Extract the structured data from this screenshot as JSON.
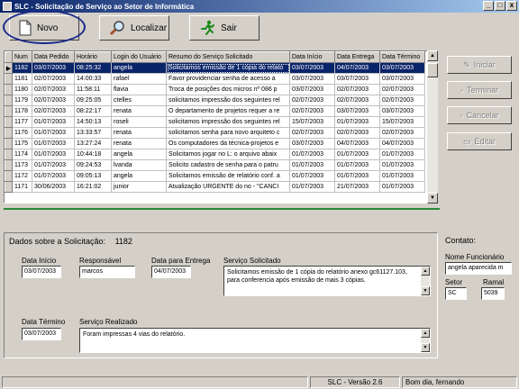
{
  "window": {
    "title": "SLC - Solicitação de Serviço ao Setor de Informática",
    "min": "_",
    "max": "□",
    "close": "x"
  },
  "toolbar": {
    "novo": "Novo",
    "localizar": "Localizar",
    "sair": "Sair"
  },
  "grid": {
    "columns": [
      "Num",
      "Data Pedido",
      "Horário",
      "Login do Usuário",
      "Resumo do Serviço Solicitado",
      "Data Início",
      "Data Entrega",
      "Data Término"
    ],
    "rows": [
      [
        "1182",
        "03/07/2003",
        "08:25:32",
        "angela",
        "Solicitamos emissão de 1 cópia do relató",
        "03/07/2003",
        "04/07/2003",
        "03/07/2003"
      ],
      [
        "1181",
        "02/07/2003",
        "14:00:33",
        "rafael",
        "Favor providenciar senha de acesso a",
        "03/07/2003",
        "03/07/2003",
        "03/07/2003"
      ],
      [
        "1180",
        "02/07/2003",
        "11:58:11",
        "flavia",
        "Troca de posições dos micros nº 086 p",
        "03/07/2003",
        "02/07/2003",
        "02/07/2003"
      ],
      [
        "1179",
        "02/07/2003",
        "09:25:05",
        "ctelles",
        "solicitamos impressão dos seguintes rel",
        "02/07/2003",
        "02/07/2003",
        "02/07/2003"
      ],
      [
        "1178",
        "02/07/2003",
        "08:22:17",
        "renata",
        "O departamento de projetos requer a re",
        "02/07/2003",
        "03/07/2003",
        "03/07/2003"
      ],
      [
        "1177",
        "01/07/2003",
        "14:50:13",
        "roseli",
        "solicitamos impressão dos seguintes rel",
        "15/07/2003",
        "01/07/2003",
        "15/07/2003"
      ],
      [
        "1176",
        "01/07/2003",
        "13:33:57",
        "renata",
        "solicitamos senha para novo arquiteto c",
        "02/07/2003",
        "02/07/2003",
        "02/07/2003"
      ],
      [
        "1175",
        "01/07/2003",
        "13:27:24",
        "renata",
        "Os computadores da técnica-projetos e",
        "03/07/2003",
        "04/07/2003",
        "04/07/2003"
      ],
      [
        "1174",
        "01/07/2003",
        "10:44:18",
        "angela",
        "Solicitamos jogar no L: o arquivo abaix",
        "01/07/2003",
        "01/07/2003",
        "01/07/2003"
      ],
      [
        "1173",
        "01/07/2003",
        "09:24:53",
        "lvanda",
        "Solicito cadastro de senha para o patru",
        "01/07/2003",
        "01/07/2003",
        "01/07/2003"
      ],
      [
        "1172",
        "01/07/2003",
        "09:05:13",
        "angela",
        "Solicitamos emissão de relatório conf. a",
        "01/07/2003",
        "01/07/2003",
        "01/07/2003"
      ],
      [
        "1171",
        "30/06/2003",
        "16:21:02",
        "junior",
        "Atualização URGENTE do no - \"CANCI",
        "01/07/2003",
        "21/07/2003",
        "01/07/2003"
      ]
    ]
  },
  "side_buttons": {
    "iniciar": "Iniciar",
    "terminar": "Terminar",
    "cancelar": "Cancelar",
    "editar": "Editar"
  },
  "details": {
    "heading": "Dados sobre a Solicitação:",
    "number": "1182",
    "data_inicio_label": "Data Início",
    "data_inicio": "03/07/2003",
    "responsavel_label": "Responsável",
    "responsavel": "marcos",
    "data_entrega_label": "Data para Entrega",
    "data_entrega": "04/07/2003",
    "servico_label": "Serviço Solicitado",
    "servico": "Solicitamos emissão de 1 cópia do relatório anexo gc61127.103,  para conferencia após emissão de mais 3 cópias.",
    "data_termino_label": "Data Término",
    "data_termino": "03/07/2003",
    "realizado_label": "Serviço Realizado",
    "realizado": "Foram impressas 4 vias do relatório."
  },
  "contact": {
    "heading": "Contato:",
    "nome_label": "Nome Funcionário",
    "nome": "angela aparecida m",
    "setor_label": "Setor",
    "setor": "SC",
    "ramal_label": "Ramal",
    "ramal": "5039"
  },
  "status": {
    "version": "SLC - Versão 2.6",
    "greeting": "Bom dia, fernando"
  }
}
